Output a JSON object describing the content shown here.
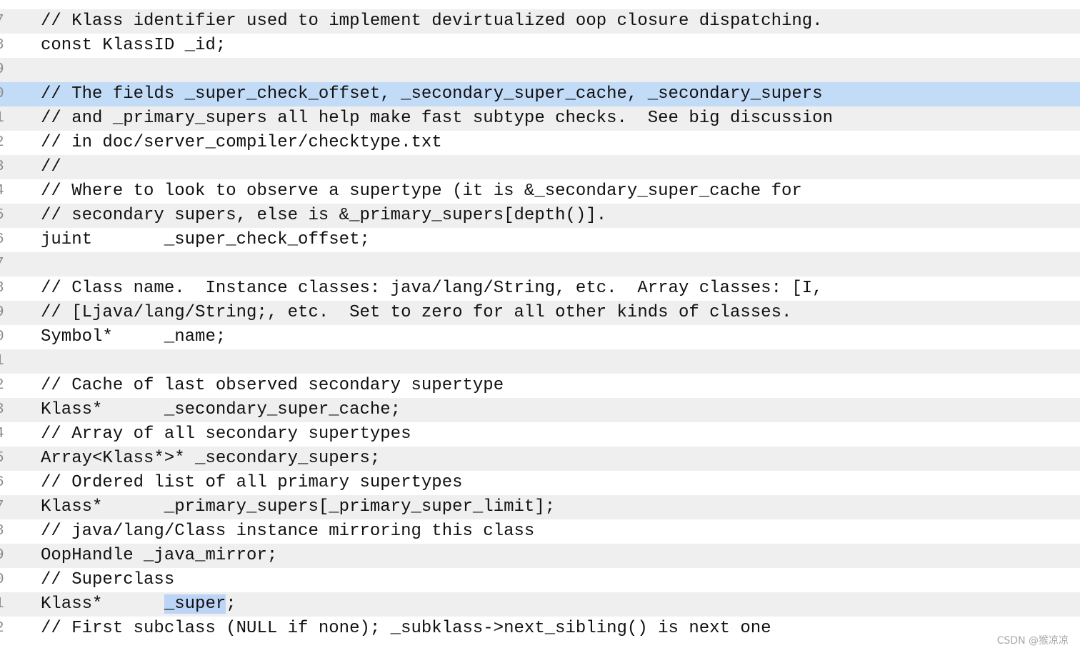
{
  "editor": {
    "lines": [
      {
        "num": "7",
        "code": "// Klass identifier used to implement devirtualized oop closure dispatching."
      },
      {
        "num": "8",
        "code": "const KlassID _id;"
      },
      {
        "num": "9",
        "code": ""
      },
      {
        "num": "0",
        "code": "// The fields _super_check_offset, _secondary_super_cache, _secondary_supers",
        "selected": true
      },
      {
        "num": "1",
        "code": "// and _primary_supers all help make fast subtype checks.  See big discussion"
      },
      {
        "num": "2",
        "code": "// in doc/server_compiler/checktype.txt"
      },
      {
        "num": "3",
        "code": "//"
      },
      {
        "num": "4",
        "code": "// Where to look to observe a supertype (it is &_secondary_super_cache for"
      },
      {
        "num": "5",
        "code": "// secondary supers, else is &_primary_supers[depth()]."
      },
      {
        "num": "6",
        "code": "juint       _super_check_offset;"
      },
      {
        "num": "7",
        "code": ""
      },
      {
        "num": "8",
        "code": "// Class name.  Instance classes: java/lang/String, etc.  Array classes: [I,"
      },
      {
        "num": "9",
        "code": "// [Ljava/lang/String;, etc.  Set to zero for all other kinds of classes."
      },
      {
        "num": "0",
        "code": "Symbol*     _name;"
      },
      {
        "num": "1",
        "code": ""
      },
      {
        "num": "2",
        "code": "// Cache of last observed secondary supertype"
      },
      {
        "num": "3",
        "code": "Klass*      _secondary_super_cache;"
      },
      {
        "num": "4",
        "code": "// Array of all secondary supertypes"
      },
      {
        "num": "5",
        "code": "Array<Klass*>* _secondary_supers;"
      },
      {
        "num": "6",
        "code": "// Ordered list of all primary supertypes"
      },
      {
        "num": "7",
        "code": "Klass*      _primary_supers[_primary_super_limit];"
      },
      {
        "num": "8",
        "code": "// java/lang/Class instance mirroring this class"
      },
      {
        "num": "9",
        "code": "OopHandle _java_mirror;"
      },
      {
        "num": "0",
        "code": "// Superclass"
      },
      {
        "num": "1",
        "code": "Klass*      _super;",
        "highlight": "_super"
      },
      {
        "num": "2",
        "code": "// First subclass (NULL if none); _subklass->next_sibling() is next one"
      }
    ]
  },
  "watermark": "CSDN @猴凉凉",
  "colors": {
    "background": "#ffffff",
    "alt_row": "#efefef",
    "selected_row": "#c2dbf7",
    "word_highlight": "#bcd4f5",
    "text": "#111111",
    "gutter_text": "#8c8c8c"
  }
}
